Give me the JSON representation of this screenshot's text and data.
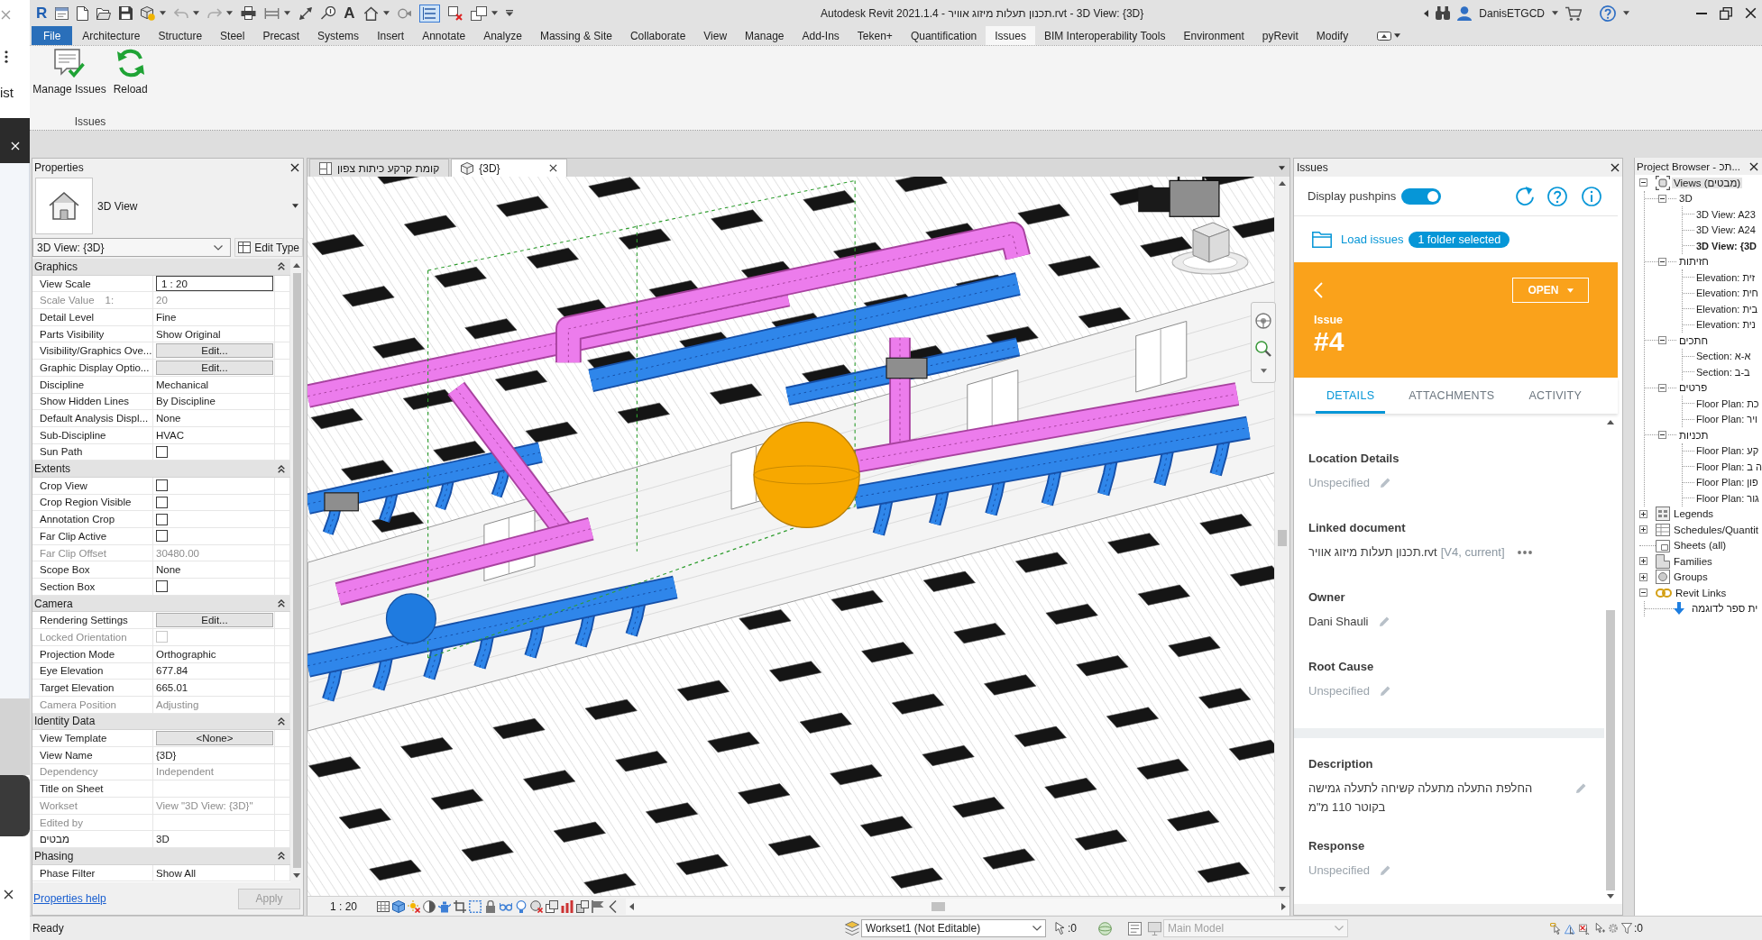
{
  "background_window": {
    "text": "ist"
  },
  "title_bar": {
    "logo": "R",
    "text_tool": "A",
    "lines_toggle": {
      "on": true
    },
    "title": "Autodesk Revit 2021.1.4 - תכנון תעלות מיזוג אוויר.rvt - 3D View: {3D}",
    "user": "DanisETGCD"
  },
  "ribbon_tabs": [
    {
      "label": "File",
      "kind": "application",
      "selected": false
    },
    {
      "label": "Architecture",
      "kind": "tab",
      "selected": false
    },
    {
      "label": "Structure",
      "kind": "tab",
      "selected": false
    },
    {
      "label": "Steel",
      "kind": "tab",
      "selected": false
    },
    {
      "label": "Precast",
      "kind": "tab",
      "selected": false
    },
    {
      "label": "Systems",
      "kind": "tab",
      "selected": false
    },
    {
      "label": "Insert",
      "kind": "tab",
      "selected": false
    },
    {
      "label": "Annotate",
      "kind": "tab",
      "selected": false
    },
    {
      "label": "Analyze",
      "kind": "tab",
      "selected": false
    },
    {
      "label": "Massing & Site",
      "kind": "tab",
      "selected": false
    },
    {
      "label": "Collaborate",
      "kind": "tab",
      "selected": false
    },
    {
      "label": "View",
      "kind": "tab",
      "selected": false
    },
    {
      "label": "Manage",
      "kind": "tab",
      "selected": false
    },
    {
      "label": "Add-Ins",
      "kind": "tab",
      "selected": false
    },
    {
      "label": "Teken+",
      "kind": "tab",
      "selected": false
    },
    {
      "label": "Quantification",
      "kind": "tab",
      "selected": false
    },
    {
      "label": "Issues",
      "kind": "tab",
      "selected": true
    },
    {
      "label": "BIM Interoperability Tools",
      "kind": "tab",
      "selected": false
    },
    {
      "label": "Environment",
      "kind": "tab",
      "selected": false
    },
    {
      "label": "pyRevit",
      "kind": "tab",
      "selected": false
    },
    {
      "label": "Modify",
      "kind": "tab",
      "selected": false
    }
  ],
  "ribbon": {
    "buttons": [
      {
        "label": "Manage Issues",
        "kind": "manage"
      },
      {
        "label": "Reload",
        "kind": "reload"
      }
    ],
    "panel_label": "Issues"
  },
  "properties": {
    "title": "Properties",
    "type_name": "3D View",
    "instance": "3D View: {3D}",
    "edit_type": "Edit Type",
    "groups": [
      {
        "name": "Graphics",
        "expanded": true,
        "rows": [
          {
            "label": "View Scale",
            "kind": "field",
            "value": "1 : 20",
            "disabled": false
          },
          {
            "label": "Scale Value",
            "prefix": "1:",
            "kind": "text",
            "value": "20",
            "disabled": true
          },
          {
            "label": "Detail Level",
            "kind": "text",
            "value": "Fine",
            "disabled": false
          },
          {
            "label": "Parts Visibility",
            "kind": "text",
            "value": "Show Original",
            "disabled": false
          },
          {
            "label": "Visibility/Graphics Ove...",
            "kind": "button",
            "value": "Edit...",
            "disabled": false
          },
          {
            "label": "Graphic Display Optio...",
            "kind": "button",
            "value": "Edit...",
            "disabled": false
          },
          {
            "label": "Discipline",
            "kind": "text",
            "value": "Mechanical",
            "disabled": false
          },
          {
            "label": "Show Hidden Lines",
            "kind": "text",
            "value": "By Discipline",
            "disabled": false
          },
          {
            "label": "Default Analysis Displ...",
            "kind": "text",
            "value": "None",
            "disabled": false
          },
          {
            "label": "Sub-Discipline",
            "kind": "text",
            "value": "HVAC",
            "disabled": false
          },
          {
            "label": "Sun Path",
            "kind": "checkbox",
            "checked": false,
            "disabled": false
          }
        ]
      },
      {
        "name": "Extents",
        "expanded": true,
        "rows": [
          {
            "label": "Crop View",
            "kind": "checkbox",
            "checked": false,
            "disabled": false
          },
          {
            "label": "Crop Region Visible",
            "kind": "checkbox",
            "checked": false,
            "disabled": false
          },
          {
            "label": "Annotation Crop",
            "kind": "checkbox",
            "checked": false,
            "disabled": false
          },
          {
            "label": "Far Clip Active",
            "kind": "checkbox",
            "checked": false,
            "disabled": false
          },
          {
            "label": "Far Clip Offset",
            "kind": "text",
            "value": "30480.00",
            "disabled": true
          },
          {
            "label": "Scope Box",
            "kind": "text",
            "value": "None",
            "disabled": false
          },
          {
            "label": "Section Box",
            "kind": "checkbox",
            "checked": false,
            "disabled": false
          }
        ]
      },
      {
        "name": "Camera",
        "expanded": true,
        "rows": [
          {
            "label": "Rendering Settings",
            "kind": "button",
            "value": "Edit...",
            "disabled": false
          },
          {
            "label": "Locked Orientation",
            "kind": "checkbox",
            "checked": false,
            "disabled": true
          },
          {
            "label": "Projection Mode",
            "kind": "text",
            "value": "Orthographic",
            "disabled": false
          },
          {
            "label": "Eye Elevation",
            "kind": "text",
            "value": "677.84",
            "disabled": false
          },
          {
            "label": "Target Elevation",
            "kind": "text",
            "value": "665.01",
            "disabled": false
          },
          {
            "label": "Camera Position",
            "kind": "text",
            "value": "Adjusting",
            "disabled": true
          }
        ]
      },
      {
        "name": "Identity Data",
        "expanded": true,
        "rows": [
          {
            "label": "View Template",
            "kind": "button",
            "value": "<None>",
            "disabled": false
          },
          {
            "label": "View Name",
            "kind": "text",
            "value": "{3D}",
            "disabled": false
          },
          {
            "label": "Dependency",
            "kind": "text",
            "value": "Independent",
            "disabled": true
          },
          {
            "label": "Title on Sheet",
            "kind": "text",
            "disabled": false
          },
          {
            "label": "Workset",
            "kind": "text",
            "value": "View \"3D View: {3D}\"",
            "disabled": true
          },
          {
            "label": "Edited by",
            "kind": "text",
            "disabled": true
          },
          {
            "label": "מבטים",
            "kind": "text",
            "value": "3D",
            "disabled": false
          }
        ]
      },
      {
        "name": "Phasing",
        "expanded": true,
        "rows": [
          {
            "label": "Phase Filter",
            "kind": "text",
            "value": "Show All",
            "disabled": false
          }
        ]
      }
    ],
    "help_link": "Properties help",
    "apply": {
      "label": "Apply",
      "disabled": true
    }
  },
  "view_tabs": [
    {
      "label": "קומת קרקע כיתות צפון",
      "kind": "plan",
      "selected": false
    },
    {
      "label": "{3D}",
      "kind": "model",
      "selected": true
    }
  ],
  "view": {
    "scale": "1 : 20"
  },
  "issues_panel": {
    "title": "Issues",
    "display_pushpins": {
      "label": "Display pushpins",
      "on": true
    },
    "load_issues": "Load issues",
    "folder_badge": "1 folder selected",
    "issue": {
      "label": "Issue",
      "number": "#4",
      "status": "OPEN"
    },
    "tabs": [
      {
        "label": "DETAILS",
        "selected": true
      },
      {
        "label": "ATTACHMENTS",
        "selected": false
      },
      {
        "label": "ACTIVITY",
        "selected": false
      }
    ],
    "field_groups": [
      {
        "fields": [
          {
            "label": "Location Details",
            "kind": "text",
            "value": "Unspecified",
            "unset": true
          },
          {
            "label": "Linked document",
            "kind": "document",
            "value": "תכנון תעלות מיזוג אוויר.rvt",
            "version": "[V4, current]",
            "unset": false
          },
          {
            "label": "Owner",
            "kind": "text",
            "value": "Dani Shauli",
            "unset": false
          },
          {
            "label": "Root Cause",
            "kind": "text",
            "value": "Unspecified",
            "unset": true
          }
        ]
      },
      {
        "fields": [
          {
            "label": "Description",
            "kind": "text",
            "value": "החלפת התעלה מתעלה קשיחה לתעלה גמישה בקוטר 110 מ\"מ",
            "unset": false
          },
          {
            "label": "Response",
            "kind": "text",
            "value": "Unspecified",
            "unset": true
          }
        ]
      }
    ]
  },
  "project_browser": {
    "title": "Project Browser - תכ...",
    "tree": [
      {
        "label": "Views (מבטים)",
        "kind": "views",
        "expanded": true,
        "selected": true,
        "children": [
          {
            "label": "3D",
            "expanded": true,
            "selected": false,
            "children": [
              {
                "label": "3D View: A23",
                "selected": false,
                "active": false
              },
              {
                "label": "3D View: A24",
                "selected": false,
                "active": false
              },
              {
                "label": "3D View: {3D",
                "selected": false,
                "active": true
              }
            ]
          },
          {
            "label": "חזיתות",
            "expanded": true,
            "selected": false,
            "children": [
              {
                "label": "Elevation: זית",
                "selected": false,
                "active": false
              },
              {
                "label": "Elevation: חית",
                "selected": false,
                "active": false
              },
              {
                "label": "Elevation: בית",
                "selected": false,
                "active": false
              },
              {
                "label": "Elevation: נית",
                "selected": false,
                "active": false
              }
            ]
          },
          {
            "label": "חתכים",
            "expanded": true,
            "selected": false,
            "children": [
              {
                "label": "Section: א-א",
                "selected": false,
                "active": false
              },
              {
                "label": "Section: ב-ב",
                "selected": false,
                "active": false
              }
            ]
          },
          {
            "label": "פרטים",
            "expanded": true,
            "selected": false,
            "children": [
              {
                "label": "Floor Plan: כת",
                "selected": false,
                "active": false
              },
              {
                "label": "Floor Plan: ויר",
                "selected": false,
                "active": false
              }
            ]
          },
          {
            "label": "תכניות",
            "expanded": true,
            "selected": false,
            "children": [
              {
                "label": "Floor Plan: קע",
                "selected": false,
                "active": false
              },
              {
                "label": "Floor Plan: ה ב",
                "selected": false,
                "active": false
              },
              {
                "label": "Floor Plan: פון",
                "selected": false,
                "active": false
              },
              {
                "label": "Floor Plan: גור",
                "selected": false,
                "active": false
              }
            ]
          }
        ]
      },
      {
        "label": "Legends",
        "kind": "legends",
        "expanded": false,
        "selected": false
      },
      {
        "label": "Schedules/Quantit",
        "kind": "schedules",
        "expanded": false,
        "selected": false
      },
      {
        "label": "Sheets (all)",
        "kind": "sheets",
        "selected": false
      },
      {
        "label": "Families",
        "kind": "families",
        "expanded": false,
        "selected": false
      },
      {
        "label": "Groups",
        "kind": "groups",
        "expanded": false,
        "selected": false
      },
      {
        "label": "Revit Links",
        "kind": "links",
        "expanded": true,
        "selected": false,
        "children": [
          {
            "label": "ית ספר לדוגמה",
            "kind": "link",
            "selected": false
          }
        ]
      }
    ]
  },
  "status_bar": {
    "message": "Ready",
    "workset": "Workset1 (Not Editable)",
    "editable_requests": ":0",
    "design_option": {
      "label": "Main Model",
      "disabled": true
    },
    "filter_count": ":0"
  }
}
